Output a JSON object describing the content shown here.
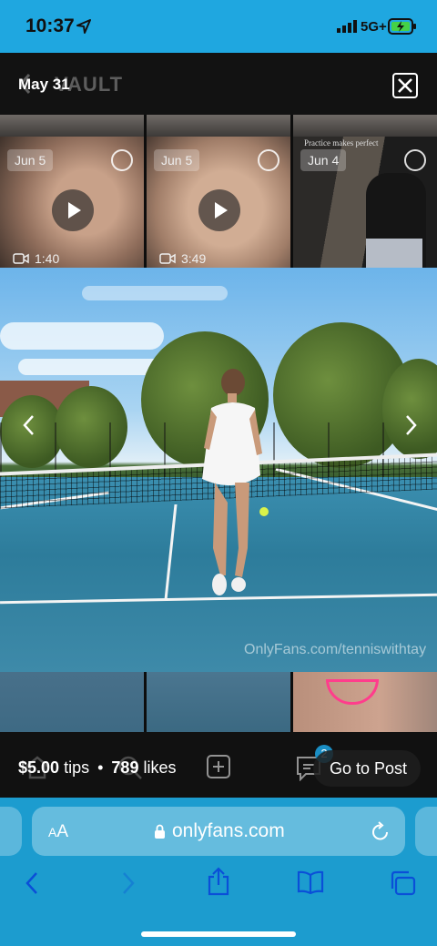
{
  "status_bar": {
    "time": "10:37",
    "network": "5G+",
    "location_icon": "location-arrow-icon",
    "signal_icon": "cellular-signal-icon",
    "battery_icon": "battery-charging-icon",
    "accent": "#1fa7e0"
  },
  "viewer": {
    "header": {
      "ghost_title": "VAULT",
      "date": "May 31"
    },
    "thumbnails": [
      {
        "date": "Jun 5",
        "duration": "1:40"
      },
      {
        "date": "Jun 5",
        "duration": "3:49"
      },
      {
        "date": "Jun 4",
        "overlay_text": "Practice makes perfect"
      }
    ],
    "watermark": "OnlyFans.com/tenniswithtay",
    "footer": {
      "tips": "$5.00",
      "tips_label": "tips",
      "separator": "•",
      "likes": "789",
      "likes_label": "likes",
      "badge_count": "2",
      "go_to_post": "Go to Post"
    }
  },
  "browser": {
    "text_size_label_small": "A",
    "text_size_label_large": "A",
    "domain": "onlyfans.com",
    "accent": "#1c9ccf"
  }
}
